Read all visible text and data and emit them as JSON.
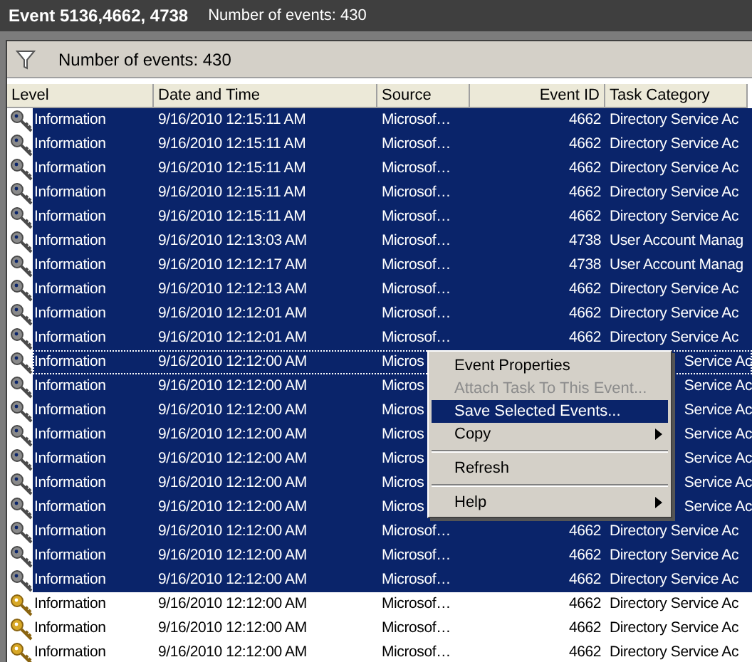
{
  "title_bar": {
    "title": "Event 5136,4662, 4738",
    "count": "Number of events: 430"
  },
  "toolbar": {
    "count": "Number of events: 430"
  },
  "table": {
    "columns": [
      "Level",
      "Date and Time",
      "Source",
      "Event ID",
      "Task Category"
    ],
    "rows": [
      {
        "level": "Information",
        "date_time": "9/16/2010 12:15:11 AM",
        "source": "Microsof…",
        "event_id": "4662",
        "task_category": "Directory Service Ac",
        "selected": true,
        "focused": false
      },
      {
        "level": "Information",
        "date_time": "9/16/2010 12:15:11 AM",
        "source": "Microsof…",
        "event_id": "4662",
        "task_category": "Directory Service Ac",
        "selected": true,
        "focused": false
      },
      {
        "level": "Information",
        "date_time": "9/16/2010 12:15:11 AM",
        "source": "Microsof…",
        "event_id": "4662",
        "task_category": "Directory Service Ac",
        "selected": true,
        "focused": false
      },
      {
        "level": "Information",
        "date_time": "9/16/2010 12:15:11 AM",
        "source": "Microsof…",
        "event_id": "4662",
        "task_category": "Directory Service Ac",
        "selected": true,
        "focused": false
      },
      {
        "level": "Information",
        "date_time": "9/16/2010 12:15:11 AM",
        "source": "Microsof…",
        "event_id": "4662",
        "task_category": "Directory Service Ac",
        "selected": true,
        "focused": false
      },
      {
        "level": "Information",
        "date_time": "9/16/2010 12:13:03 AM",
        "source": "Microsof…",
        "event_id": "4738",
        "task_category": "User Account Manag",
        "selected": true,
        "focused": false
      },
      {
        "level": "Information",
        "date_time": "9/16/2010 12:12:17 AM",
        "source": "Microsof…",
        "event_id": "4738",
        "task_category": "User Account Manag",
        "selected": true,
        "focused": false
      },
      {
        "level": "Information",
        "date_time": "9/16/2010 12:12:13 AM",
        "source": "Microsof…",
        "event_id": "4662",
        "task_category": "Directory Service Ac",
        "selected": true,
        "focused": false
      },
      {
        "level": "Information",
        "date_time": "9/16/2010 12:12:01 AM",
        "source": "Microsof…",
        "event_id": "4662",
        "task_category": "Directory Service Ac",
        "selected": true,
        "focused": false
      },
      {
        "level": "Information",
        "date_time": "9/16/2010 12:12:01 AM",
        "source": "Microsof…",
        "event_id": "4662",
        "task_category": "Directory Service Ac",
        "selected": true,
        "focused": false
      },
      {
        "level": "Information",
        "date_time": "9/16/2010 12:12:00 AM",
        "source": "Micros",
        "task_category": "Service Ac",
        "selected": true,
        "focused": true
      },
      {
        "level": "Information",
        "date_time": "9/16/2010 12:12:00 AM",
        "source": "Micros",
        "task_category": "Service Ac",
        "selected": true,
        "focused": false
      },
      {
        "level": "Information",
        "date_time": "9/16/2010 12:12:00 AM",
        "source": "Micros",
        "task_category": "Service Ac",
        "selected": true,
        "focused": false
      },
      {
        "level": "Information",
        "date_time": "9/16/2010 12:12:00 AM",
        "source": "Micros",
        "task_category": "Service Ac",
        "selected": true,
        "focused": false
      },
      {
        "level": "Information",
        "date_time": "9/16/2010 12:12:00 AM",
        "source": "Micros",
        "task_category": "Service Ac",
        "selected": true,
        "focused": false
      },
      {
        "level": "Information",
        "date_time": "9/16/2010 12:12:00 AM",
        "source": "Micros",
        "task_category": "Service Ac",
        "selected": true,
        "focused": false
      },
      {
        "level": "Information",
        "date_time": "9/16/2010 12:12:00 AM",
        "source": "Micros",
        "task_category": "Service Ac",
        "selected": true,
        "focused": false
      },
      {
        "level": "Information",
        "date_time": "9/16/2010 12:12:00 AM",
        "source": "Microsof…",
        "event_id": "4662",
        "task_category": "Directory Service Ac",
        "selected": true,
        "focused": false
      },
      {
        "level": "Information",
        "date_time": "9/16/2010 12:12:00 AM",
        "source": "Microsof…",
        "event_id": "4662",
        "task_category": "Directory Service Ac",
        "selected": true,
        "focused": false
      },
      {
        "level": "Information",
        "date_time": "9/16/2010 12:12:00 AM",
        "source": "Microsof…",
        "event_id": "4662",
        "task_category": "Directory Service Ac",
        "selected": true,
        "focused": false
      },
      {
        "level": "Information",
        "date_time": "9/16/2010 12:12:00 AM",
        "source": "Microsof…",
        "event_id": "4662",
        "task_category": "Directory Service Ac",
        "selected": false,
        "focused": false
      },
      {
        "level": "Information",
        "date_time": "9/16/2010 12:12:00 AM",
        "source": "Microsof…",
        "event_id": "4662",
        "task_category": "Directory Service Ac",
        "selected": false,
        "focused": false
      },
      {
        "level": "Information",
        "date_time": "9/16/2010 12:12:00 AM",
        "source": "Microsof…",
        "event_id": "4662",
        "task_category": "Directory Service Ac",
        "selected": false,
        "focused": false
      }
    ]
  },
  "context_menu": {
    "items": [
      {
        "kind": "item",
        "label": "Event Properties",
        "disabled": false,
        "selected": false,
        "submenu": false
      },
      {
        "kind": "item",
        "label": "Attach Task To This Event...",
        "disabled": true,
        "selected": false,
        "submenu": false
      },
      {
        "kind": "item",
        "label": "Save Selected Events...",
        "disabled": false,
        "selected": true,
        "submenu": false
      },
      {
        "kind": "item",
        "label": "Copy",
        "disabled": false,
        "selected": false,
        "submenu": true
      },
      {
        "kind": "separator"
      },
      {
        "kind": "item",
        "label": "Refresh",
        "disabled": false,
        "selected": false,
        "submenu": false
      },
      {
        "kind": "separator"
      },
      {
        "kind": "item",
        "label": "Help",
        "disabled": false,
        "selected": false,
        "submenu": true
      }
    ]
  }
}
